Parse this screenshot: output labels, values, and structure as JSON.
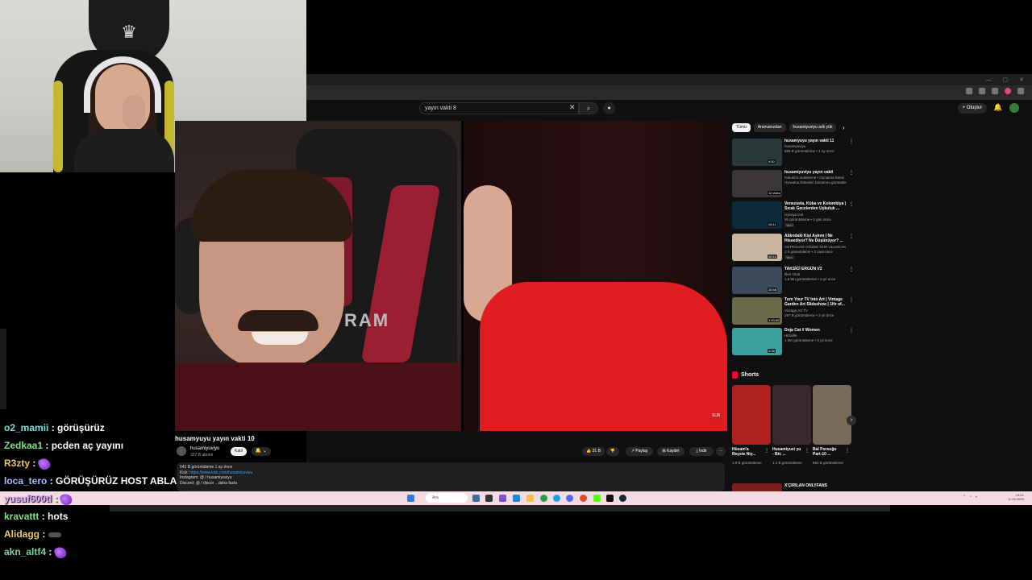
{
  "browser": {
    "search_query": "yayın vakti 8",
    "create_label": "Oluştur",
    "notification_count": "9+"
  },
  "video": {
    "title": "husamyuyu yayın vakti 10",
    "channel": "husamiyuviyu",
    "subscribers": "327 B abone",
    "join_label": "Katıl",
    "likes": "31 B",
    "share_label": "Paylaş",
    "save_label": "Kaydet",
    "download_label": "İndir",
    "chair_text": "RAM",
    "sub_badge": "SUB"
  },
  "description": {
    "stats": "541 B görüntüleme  1 ay önce",
    "kick_label": "Kick:",
    "kick_link": "https://www.kick.com/husamiyuviyu",
    "instagram": "Instagram: @ / husamiyuviyu",
    "discord": "Discord: @ / discor",
    "more": "...daha fazla"
  },
  "sidebar": {
    "chips": [
      "Tümü",
      "Aramanızdan",
      "husamiyuviyu adlı yük"
    ],
    "recommendations": [
      {
        "title": "husamyuyu yayın vakti 11",
        "channel": "husamyuviyu",
        "meta": "568 B görüntüleme • 1 ay önce",
        "duration": "9:50",
        "color": "#2a3a3a"
      },
      {
        "title": "husamiyuviyu yayın vakti",
        "channel": "hukukrm.makaleme • Oynatma listesi",
        "meta": "Oynatma listesinin tamamını görüntüle",
        "duration": "12 video",
        "color": "#3a3636"
      },
      {
        "title": "Venezuela, Küba ve Kolombiya | Sıcak Gecelerden Uykuluk ...",
        "channel": "Uykuya Dal",
        "meta": "5b görüntüleme • 2 gün önce",
        "tag": "Yeni",
        "duration": "28:11",
        "color": "#0c2a3c"
      },
      {
        "title": "Aldındaki Kişi Aşkını | Ne Hissediyor? Ne Düşünüyor? ...",
        "channel": "ASTROLOG GÖZDE NUR ULUOCAK",
        "meta": "2 b görüntüleme • 2 saat önce",
        "tag": "Yeni",
        "duration": "40:10",
        "color": "#c9b6a0"
      },
      {
        "title": "TAKSİCİ ERGÜN V2",
        "channel": "İlker Ünal",
        "meta": "1,9 Mn görüntüleme • 3 yıl önce",
        "duration": "26:58",
        "color": "#3a4a5a"
      },
      {
        "title": "Turn Your TV Into Art | Vintage Garden Art Slideshow | 1Hr of...",
        "channel": "Vintage Art TV",
        "meta": "297 B görüntüleme • 3 yıl önce",
        "duration": "1:00:00",
        "color": "#6a6a4a"
      },
      {
        "title": "Doja Cat // Women",
        "channel": "Hitsville",
        "meta": "1 Mn görüntüleme • 3 yıl önce",
        "duration": "3:38",
        "color": "#3aa0a0"
      }
    ],
    "shorts_label": "Shorts",
    "shorts": [
      {
        "title": "Hüsam'a Reçete Niy...",
        "meta": "1,9 B görüntüleme",
        "color": "#b02020"
      },
      {
        "title": "Husamiyuvi yu - Btc ...",
        "meta": "1,4 B görüntüleme",
        "color": "#3a2a30"
      },
      {
        "title": "Bal Porsuğu Part-10 ...",
        "meta": "864 B görüntüleme",
        "color": "#7a6a5a"
      }
    ],
    "next_title": "X'ÇIRILAN ONLYFANS"
  },
  "taskbar": {
    "search_label": "Ara",
    "clock_time": "19:01",
    "clock_date": "11.03.2025"
  },
  "chat": [
    {
      "user": "o2_mamii",
      "message": "görüşürüz",
      "color": "#7fe0d8"
    },
    {
      "user": "Zedkaa1",
      "message": "pcden aç yayını",
      "color": "#7fe07f"
    },
    {
      "user": "R3zty",
      "message": "",
      "color": "#e8c86a",
      "emote": "purple"
    },
    {
      "user": "loca_tero",
      "message": "GÖRÜŞÜRÜZ HOST ABLA",
      "color": "#9fc0ff"
    },
    {
      "user": "yusuf600tl",
      "message": "",
      "color": "#d9a0ff",
      "emote": "purple"
    },
    {
      "user": "kravattt",
      "message": "hots",
      "color": "#7fe07f"
    },
    {
      "user": "Alidagg",
      "message": "",
      "color": "#e8c86a",
      "emote": "glasses"
    },
    {
      "user": "akn_altf4",
      "message": "",
      "color": "#7fd0a0",
      "emote": "purple"
    }
  ]
}
